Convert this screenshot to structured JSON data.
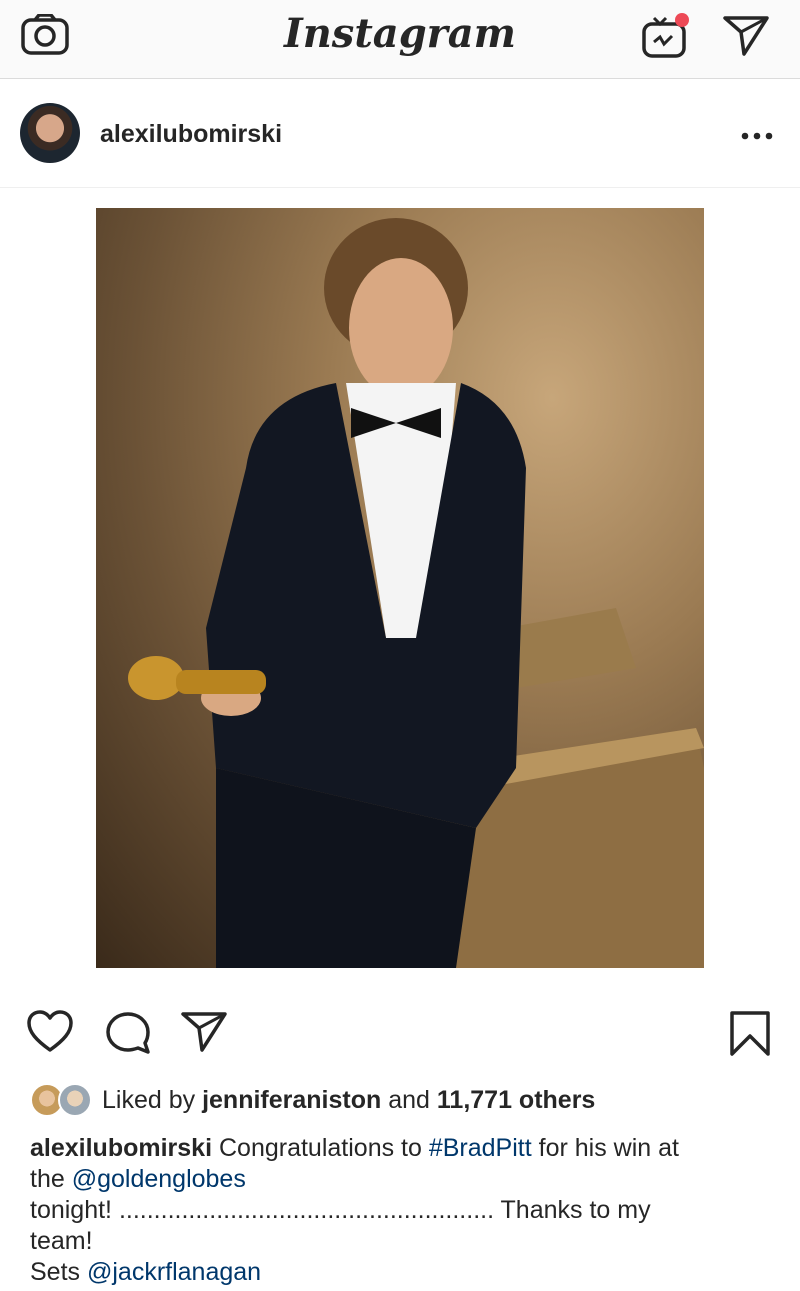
{
  "app": {
    "title": "Instagram",
    "camera_icon": "camera-icon",
    "igtv_icon": "igtv-icon",
    "direct_icon": "paper-plane-icon",
    "notification_color": "#ed4956"
  },
  "post": {
    "author": "alexilubomirski",
    "more_icon": "more-options-icon",
    "image_alt": "Photo post",
    "actions": {
      "like_icon": "heart-icon",
      "comment_icon": "comment-icon",
      "share_icon": "paper-plane-icon",
      "save_icon": "bookmark-icon"
    },
    "likes": {
      "prefix": "Liked by",
      "user": "jenniferaniston",
      "joiner": "and",
      "others": "11,771 others"
    },
    "caption": {
      "author": "alexilubomirski",
      "line1_text": "Congratulations to",
      "hashtag": "#BradPitt",
      "line1_tail": "for his win at",
      "line2_text": "the",
      "mention1": "@goldenglobes",
      "line3_text": "tonight! ...................................................... Thanks to my",
      "line4_text": "team!",
      "line5_text": "Sets",
      "mention2": "@jackrflanagan"
    },
    "link_color": "#00376b"
  }
}
